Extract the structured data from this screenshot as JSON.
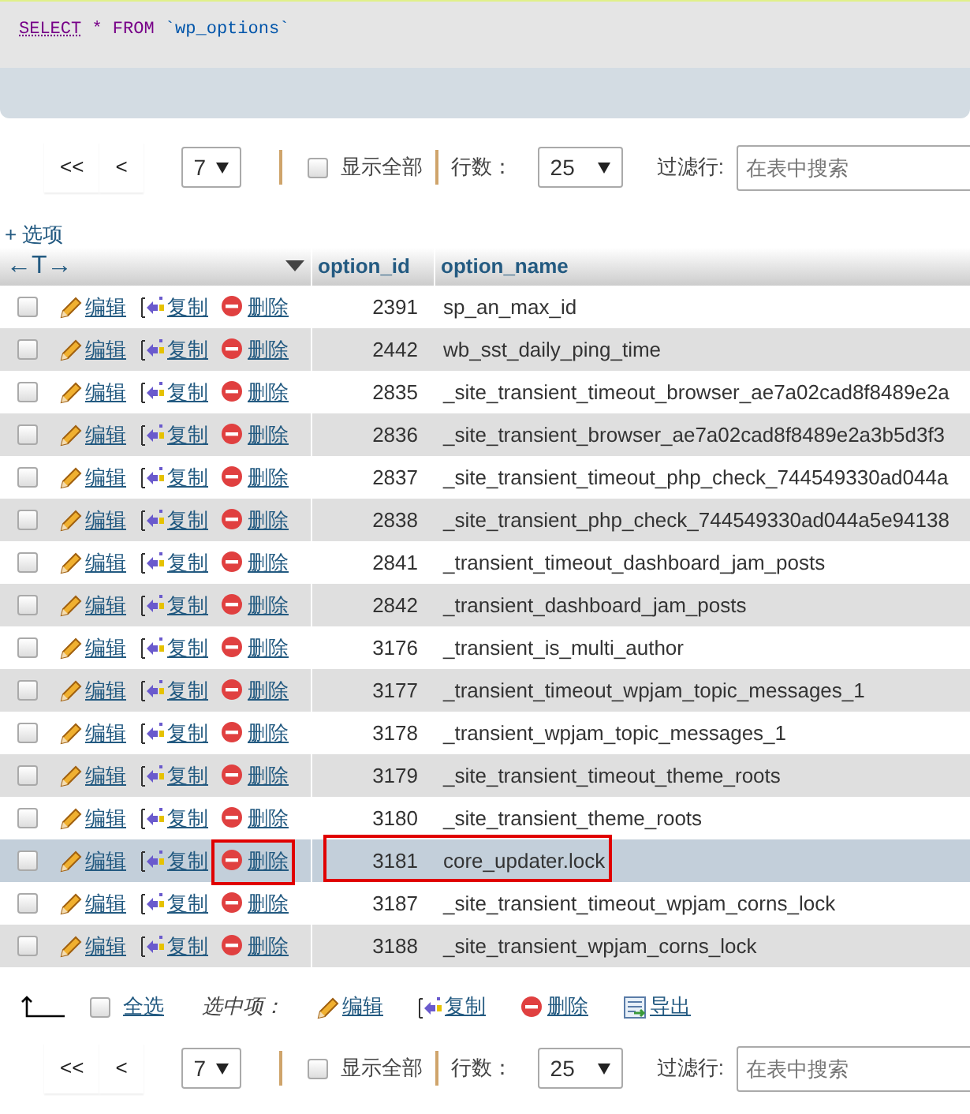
{
  "query": {
    "keyword1": "SELECT",
    "star": "*",
    "keyword2": "FROM",
    "table": "`wp_options`"
  },
  "pager_top": {
    "first": "<<",
    "prev": "<",
    "page": "7",
    "show_all": "显示全部",
    "show_all_checked": false,
    "rows_label": "行数：",
    "rows": "25",
    "filter_label": "过滤行:",
    "filter_placeholder": "在表中搜索"
  },
  "options_link": "+ 选项",
  "columns": {
    "arrows": "←T→",
    "column_1": "option_id",
    "column_2": "option_name"
  },
  "rows": [
    {
      "checked": false,
      "highlighted": false,
      "annotated": false,
      "edit": "编辑",
      "copy": "复制",
      "delete": "删除",
      "option_id": "2391",
      "option_name": "sp_an_max_id"
    },
    {
      "checked": false,
      "highlighted": false,
      "annotated": false,
      "edit": "编辑",
      "copy": "复制",
      "delete": "删除",
      "option_id": "2442",
      "option_name": "wb_sst_daily_ping_time"
    },
    {
      "checked": false,
      "highlighted": false,
      "annotated": false,
      "edit": "编辑",
      "copy": "复制",
      "delete": "删除",
      "option_id": "2835",
      "option_name": "_site_transient_timeout_browser_ae7a02cad8f8489e2a"
    },
    {
      "checked": false,
      "highlighted": false,
      "annotated": false,
      "edit": "编辑",
      "copy": "复制",
      "delete": "删除",
      "option_id": "2836",
      "option_name": "_site_transient_browser_ae7a02cad8f8489e2a3b5d3f3"
    },
    {
      "checked": false,
      "highlighted": false,
      "annotated": false,
      "edit": "编辑",
      "copy": "复制",
      "delete": "删除",
      "option_id": "2837",
      "option_name": "_site_transient_timeout_php_check_744549330ad044a"
    },
    {
      "checked": false,
      "highlighted": false,
      "annotated": false,
      "edit": "编辑",
      "copy": "复制",
      "delete": "删除",
      "option_id": "2838",
      "option_name": "_site_transient_php_check_744549330ad044a5e94138"
    },
    {
      "checked": false,
      "highlighted": false,
      "annotated": false,
      "edit": "编辑",
      "copy": "复制",
      "delete": "删除",
      "option_id": "2841",
      "option_name": "_transient_timeout_dashboard_jam_posts"
    },
    {
      "checked": false,
      "highlighted": false,
      "annotated": false,
      "edit": "编辑",
      "copy": "复制",
      "delete": "删除",
      "option_id": "2842",
      "option_name": "_transient_dashboard_jam_posts"
    },
    {
      "checked": false,
      "highlighted": false,
      "annotated": false,
      "edit": "编辑",
      "copy": "复制",
      "delete": "删除",
      "option_id": "3176",
      "option_name": "_transient_is_multi_author"
    },
    {
      "checked": false,
      "highlighted": false,
      "annotated": false,
      "edit": "编辑",
      "copy": "复制",
      "delete": "删除",
      "option_id": "3177",
      "option_name": "_transient_timeout_wpjam_topic_messages_1"
    },
    {
      "checked": false,
      "highlighted": false,
      "annotated": false,
      "edit": "编辑",
      "copy": "复制",
      "delete": "删除",
      "option_id": "3178",
      "option_name": "_transient_wpjam_topic_messages_1"
    },
    {
      "checked": false,
      "highlighted": false,
      "annotated": false,
      "edit": "编辑",
      "copy": "复制",
      "delete": "删除",
      "option_id": "3179",
      "option_name": "_site_transient_timeout_theme_roots"
    },
    {
      "checked": false,
      "highlighted": false,
      "annotated": false,
      "edit": "编辑",
      "copy": "复制",
      "delete": "删除",
      "option_id": "3180",
      "option_name": "_site_transient_theme_roots"
    },
    {
      "checked": false,
      "highlighted": true,
      "annotated": true,
      "edit": "编辑",
      "copy": "复制",
      "delete": "删除",
      "option_id": "3181",
      "option_name": "core_updater.lock"
    },
    {
      "checked": false,
      "highlighted": false,
      "annotated": false,
      "edit": "编辑",
      "copy": "复制",
      "delete": "删除",
      "option_id": "3187",
      "option_name": "_site_transient_timeout_wpjam_corns_lock"
    },
    {
      "checked": false,
      "highlighted": false,
      "annotated": false,
      "edit": "编辑",
      "copy": "复制",
      "delete": "删除",
      "option_id": "3188",
      "option_name": "_site_transient_wpjam_corns_lock"
    }
  ],
  "bulk": {
    "select_all": "全选",
    "select_all_checked": false,
    "with_selected": "选中项：",
    "edit": "编辑",
    "copy": "复制",
    "delete": "删除",
    "export": "导出"
  },
  "pager_bottom": {
    "first": "<<",
    "prev": "<",
    "page": "7",
    "show_all": "显示全部",
    "show_all_checked": false,
    "rows_label": "行数：",
    "rows": "25",
    "filter_label": "过滤行:",
    "filter_placeholder": "在表中搜索"
  }
}
